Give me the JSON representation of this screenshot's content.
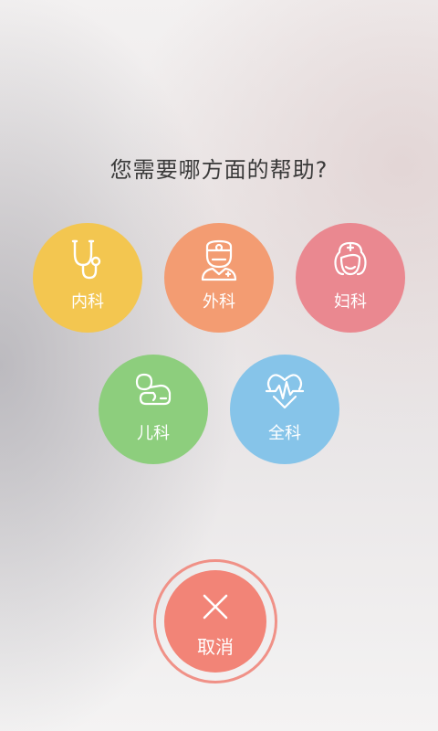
{
  "question": "您需要哪方面的帮助?",
  "departments": [
    {
      "label": "内科",
      "icon": "stethoscope-icon",
      "color": "#f3c650"
    },
    {
      "label": "外科",
      "icon": "surgeon-icon",
      "color": "#f39c72"
    },
    {
      "label": "妇科",
      "icon": "nurse-icon",
      "color": "#ea8890"
    },
    {
      "label": "儿科",
      "icon": "baby-icon",
      "color": "#8dce7d"
    },
    {
      "label": "全科",
      "icon": "heartbeat-icon",
      "color": "#86c4e9"
    }
  ],
  "cancel": {
    "label": "取消",
    "icon": "close-icon",
    "color": "#f28477"
  }
}
